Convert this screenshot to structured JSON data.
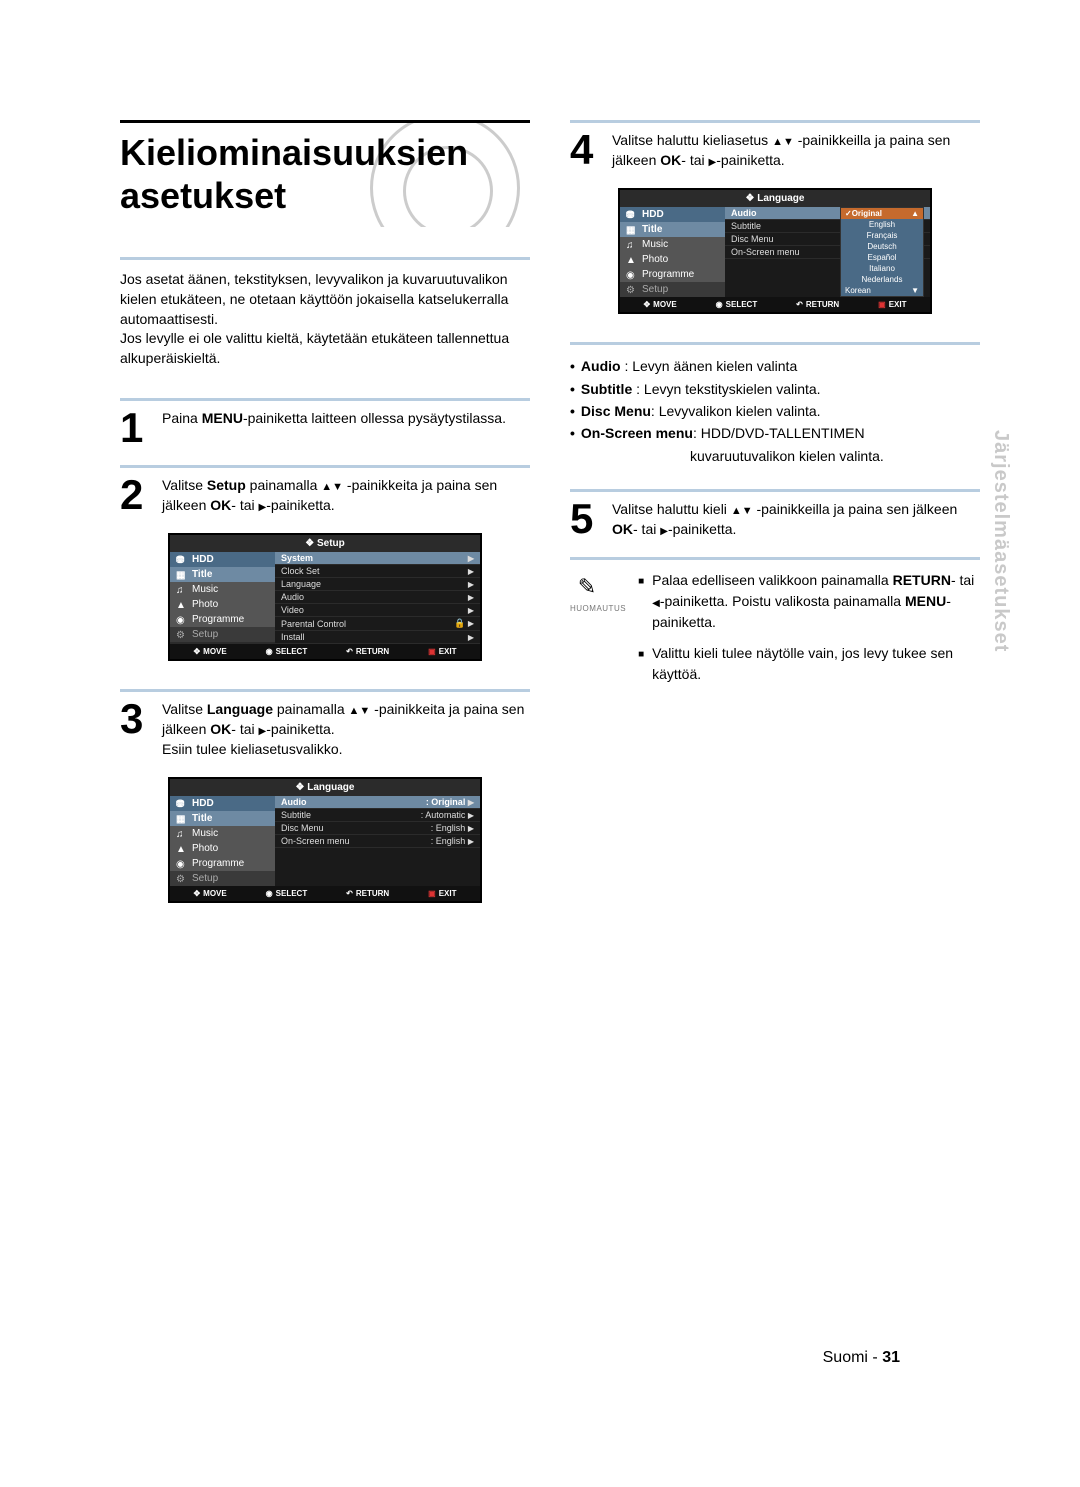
{
  "title": "Kieliominaisuuksien asetukset",
  "intro1": "Jos asetat äänen, tekstityksen, levyvalikon ja kuvaruutuvalikon kielen etukäteen, ne otetaan käyttöön jokaisella katselukerralla automaattisesti.",
  "intro2": "Jos levylle ei ole valittu kieltä, käytetään etukäteen tallennettua alkuperäiskieltä.",
  "steps": {
    "s1": {
      "num": "1",
      "text_a": "Paina ",
      "b1": "MENU",
      "text_b": "-painiketta laitteen ollessa pysäytystilassa."
    },
    "s2": {
      "num": "2",
      "text_a": "Valitse ",
      "b1": "Setup",
      "text_b": " painamalla ",
      "text_c": " -painikkeita ja paina sen jälkeen ",
      "b2": "OK",
      "text_d": "- tai ",
      "text_e": "-painiketta."
    },
    "s3": {
      "num": "3",
      "text_a": "Valitse ",
      "b1": "Language",
      "text_b": " painamalla ",
      "text_c": " -painikkeita ja paina sen jälkeen ",
      "b2": "OK",
      "text_d": "- tai ",
      "text_e": "-painiketta.",
      "extra": "Esiin tulee kieliasetusvalikko."
    },
    "s4": {
      "num": "4",
      "text_a": "Valitse haluttu kieliasetus ",
      "text_b": " -painikkeilla ja paina sen jälkeen ",
      "b1": "OK",
      "text_c": "- tai ",
      "text_d": "-painiketta."
    },
    "s5": {
      "num": "5",
      "text_a": "Valitse haluttu kieli ",
      "text_b": " -painikkeilla ja paina sen jälkeen ",
      "b1": "OK",
      "text_c": "- tai ",
      "text_d": "-painiketta."
    }
  },
  "osd_setup": {
    "title": "Setup",
    "side_hdd": "HDD",
    "side": [
      "Title",
      "Music",
      "Photo",
      "Programme",
      "Setup"
    ],
    "main": [
      {
        "l": "System",
        "r": "",
        "sel": true
      },
      {
        "l": "Clock Set",
        "r": ""
      },
      {
        "l": "Language",
        "r": ""
      },
      {
        "l": "Audio",
        "r": ""
      },
      {
        "l": "Video",
        "r": ""
      },
      {
        "l": "Parental Control",
        "r": "🔒"
      },
      {
        "l": "Install",
        "r": ""
      }
    ]
  },
  "osd_lang1": {
    "title": "Language",
    "main": [
      {
        "l": "Audio",
        "r": ": Original",
        "sel": true
      },
      {
        "l": "Subtitle",
        "r": ": Automatic"
      },
      {
        "l": "Disc Menu",
        "r": ": English"
      },
      {
        "l": "On-Screen menu",
        "r": ": English"
      }
    ]
  },
  "osd_lang2": {
    "title": "Language",
    "main": [
      {
        "l": "Audio",
        "sel": true
      },
      {
        "l": "Subtitle"
      },
      {
        "l": "Disc Menu"
      },
      {
        "l": "On-Screen menu"
      }
    ],
    "popup": [
      "Original",
      "English",
      "Français",
      "Deutsch",
      "Español",
      "Italiano",
      "Nederlands",
      "Korean"
    ]
  },
  "osd_footer": {
    "move": "MOVE",
    "select": "SELECT",
    "return": "RETURN",
    "exit": "EXIT"
  },
  "bullets": {
    "b1": {
      "lab": "Audio",
      "txt": " : Levyn äänen kielen valinta"
    },
    "b2": {
      "lab": "Subtitle",
      "txt": " : Levyn tekstityskielen valinta."
    },
    "b3": {
      "lab": "Disc Menu",
      "txt": ": Levyvalikon kielen valinta."
    },
    "b4": {
      "lab": "On-Screen menu",
      "txt": ": HDD/DVD-TALLENTIMEN"
    },
    "b4_cont": "kuvaruutuvalikon kielen valinta."
  },
  "note": {
    "label": "HUOMAUTUS",
    "n1a": "Palaa edelliseen valikkoon painamalla ",
    "n1b": "RETURN",
    "n1c": "- tai ",
    "n1d": "-painiketta. Poistu valikosta painamalla ",
    "n1e": "MENU",
    "n1f": "-painiketta.",
    "n2": "Valittu kieli tulee näytölle vain, jos levy tukee sen käyttöä."
  },
  "sidetab": "Järjestelmäasetukset",
  "footer": {
    "lang": "Suomi",
    "dash": " - ",
    "page": "31"
  }
}
